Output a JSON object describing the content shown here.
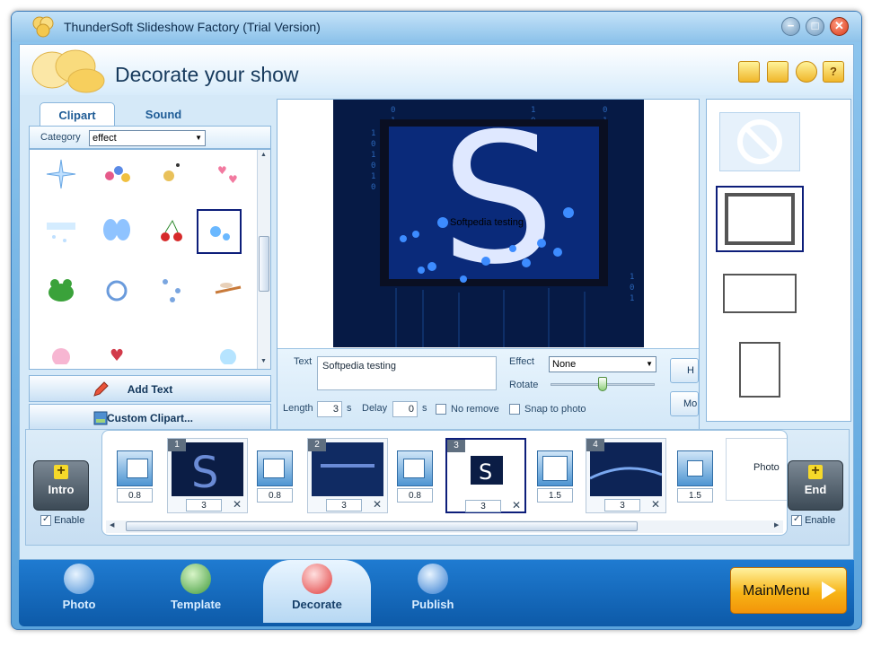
{
  "window": {
    "title": "ThunderSoft Slideshow Factory (Trial Version)",
    "controls": {
      "minimize": "−",
      "maximize": "□",
      "close": "✕"
    }
  },
  "header": {
    "title": "Decorate your show",
    "icons": [
      "folder-icon",
      "save-icon",
      "user-icon",
      "help-icon"
    ],
    "help_glyph": "?"
  },
  "clipart_panel": {
    "tabs": [
      {
        "label": "Clipart",
        "active": true
      },
      {
        "label": "Sound",
        "active": false
      }
    ],
    "category_label": "Category",
    "category_value": "effect",
    "items": [
      "sparkle",
      "ornaments",
      "bubbles-gold",
      "hearts",
      "snow",
      "butterfly",
      "cherries",
      "bubbles",
      "frog",
      "ring",
      "balloons",
      "dragonfly",
      "pink-glow",
      "heart-wings",
      "blank",
      "blue-glow"
    ],
    "selected_item": "bubbles",
    "add_text_label": "Add Text",
    "custom_clipart_label": "Custom Clipart..."
  },
  "preview": {
    "overlay_text": "Softpedia testing",
    "letter": "S"
  },
  "properties": {
    "text_label": "Text",
    "text_value": "Softpedia testing",
    "length_label": "Length",
    "length_value": "3",
    "length_unit": "s",
    "delay_label": "Delay",
    "delay_value": "0",
    "delay_unit": "s",
    "no_remove_label": "No remove",
    "no_remove_checked": false,
    "effect_label": "Effect",
    "effect_value": "None",
    "rotate_label": "Rotate",
    "rotate_fraction": 0.5,
    "snap_label": "Snap to photo",
    "snap_checked": false,
    "side_button_1": "H",
    "side_button_2": "Mo"
  },
  "frames": {
    "selected_index": 1
  },
  "storyboard": {
    "intro": {
      "label": "Intro",
      "enable_label": "Enable",
      "enabled": true
    },
    "end": {
      "label": "End",
      "enable_label": "Enable",
      "enabled": true
    },
    "items": [
      {
        "kind": "transition",
        "duration": "0.8"
      },
      {
        "kind": "scene",
        "number": "1",
        "duration": "3",
        "selected": false
      },
      {
        "kind": "transition",
        "duration": "0.8"
      },
      {
        "kind": "scene",
        "number": "2",
        "duration": "3",
        "selected": false
      },
      {
        "kind": "transition",
        "duration": "0.8"
      },
      {
        "kind": "scene",
        "number": "3",
        "duration": "3",
        "selected": true
      },
      {
        "kind": "transition",
        "duration": "1.5"
      },
      {
        "kind": "scene",
        "number": "4",
        "duration": "3",
        "selected": false
      },
      {
        "kind": "transition",
        "duration": "1.5"
      }
    ],
    "photo_placeholder": "Photo"
  },
  "nav": {
    "items": [
      {
        "label": "Photo",
        "active": false
      },
      {
        "label": "Template",
        "active": false
      },
      {
        "label": "Decorate",
        "active": true
      },
      {
        "label": "Publish",
        "active": false
      }
    ],
    "main_menu_label": "MainMenu"
  },
  "colors": {
    "accent": "#1f7bd1",
    "selection": "#0d1e7a",
    "main_menu": "#f7b416"
  }
}
